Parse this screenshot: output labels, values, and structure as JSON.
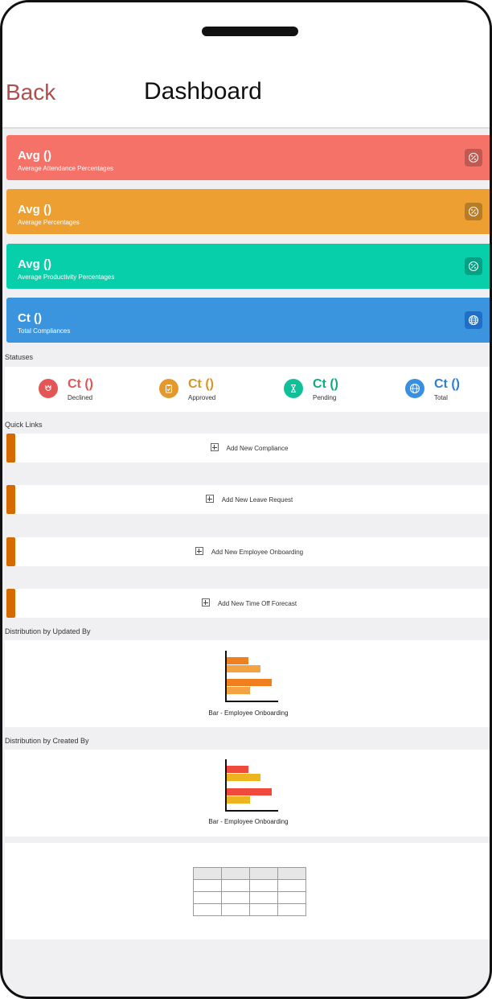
{
  "header": {
    "back_label": "Back",
    "title": "Dashboard"
  },
  "kpis": [
    {
      "value": "Avg ()",
      "desc": "Average Attendance Percentages",
      "color": "#f57268",
      "icon": "percent-icon"
    },
    {
      "value": "Avg ()",
      "desc": "Average Percentages",
      "color": "#ed9f31",
      "icon": "percent-icon"
    },
    {
      "value": "Avg ()",
      "desc": "Average Productivity Percentages",
      "color": "#07cfaa",
      "icon": "percent-icon"
    },
    {
      "value": "Ct ()",
      "desc": "Total Compliances",
      "color": "#3b95de",
      "icon": "globe-icon"
    }
  ],
  "statuses": {
    "label": "Statuses",
    "items": [
      {
        "value": "Ct ()",
        "label": "Declined",
        "color": "#e25656",
        "icon": "tulip-icon"
      },
      {
        "value": "Ct ()",
        "label": "Approved",
        "color": "#e39a2b",
        "icon": "clipboard-icon"
      },
      {
        "value": "Ct ()",
        "label": "Pending",
        "color": "#11bf99",
        "icon": "hourglass-icon"
      },
      {
        "value": "Ct ()",
        "label": "Total",
        "color": "#3b8fe0",
        "icon": "globe-icon"
      }
    ]
  },
  "quick_links": {
    "label": "Quick Links",
    "items": [
      {
        "label": "Add New Compliance"
      },
      {
        "label": "Add New Leave Request"
      },
      {
        "label": "Add New Employee Onboarding"
      },
      {
        "label": "Add New Time Off Forecast"
      }
    ]
  },
  "charts": [
    {
      "section_label": "Distribution by Updated By",
      "caption": "Bar - Employee Onboarding",
      "colors": [
        "#f0801f",
        "#f4a343"
      ]
    },
    {
      "section_label": "Distribution by Created By",
      "caption": "Bar - Employee Onboarding",
      "colors": [
        "#ef4a3c",
        "#ecb520"
      ]
    }
  ]
}
